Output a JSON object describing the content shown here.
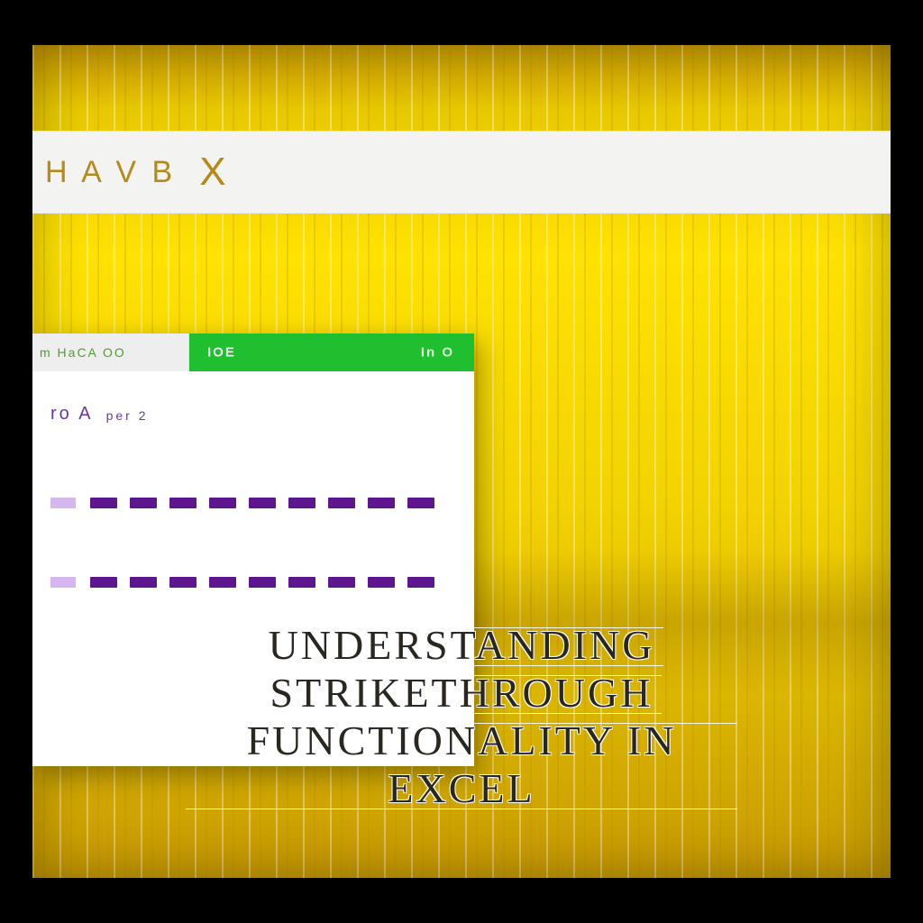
{
  "topbar": {
    "glyphs": "H A V B",
    "x": "X"
  },
  "window": {
    "tab_inactive": "m HaCA OO",
    "tab_badge": "IOE",
    "tab_tool": "In O",
    "label_main": "ro A",
    "label_sub": "per 2"
  },
  "overlay": {
    "line1": "Understanding",
    "line2": "Strikethrough",
    "line3": "Functionality in Excel"
  }
}
